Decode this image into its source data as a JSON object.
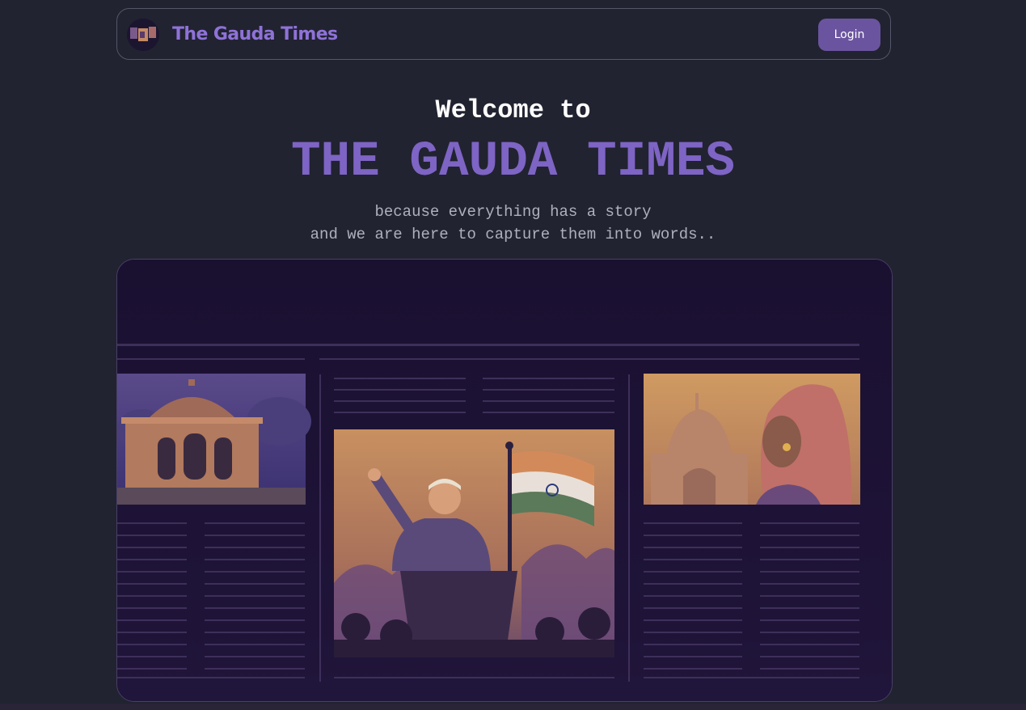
{
  "header": {
    "logo_icon": "gauda-times-logo-icon",
    "brand": "The Gauda Times",
    "login_label": "Login"
  },
  "hero": {
    "welcome": "Welcome to",
    "title": "THE GAUDA TIMES",
    "tagline_line1": "because everything has a story",
    "tagline_line2": "and we are here to capture them into words.."
  },
  "banner": {
    "illustration": "newspaper-collage-illustration",
    "panels": [
      "temple-ruins-icon",
      "speaker-with-flag-icon",
      "woman-with-taj-mahal-icon"
    ]
  },
  "colors": {
    "background": "#212330",
    "accent": "#7e64c4",
    "button": "#6b549f"
  }
}
